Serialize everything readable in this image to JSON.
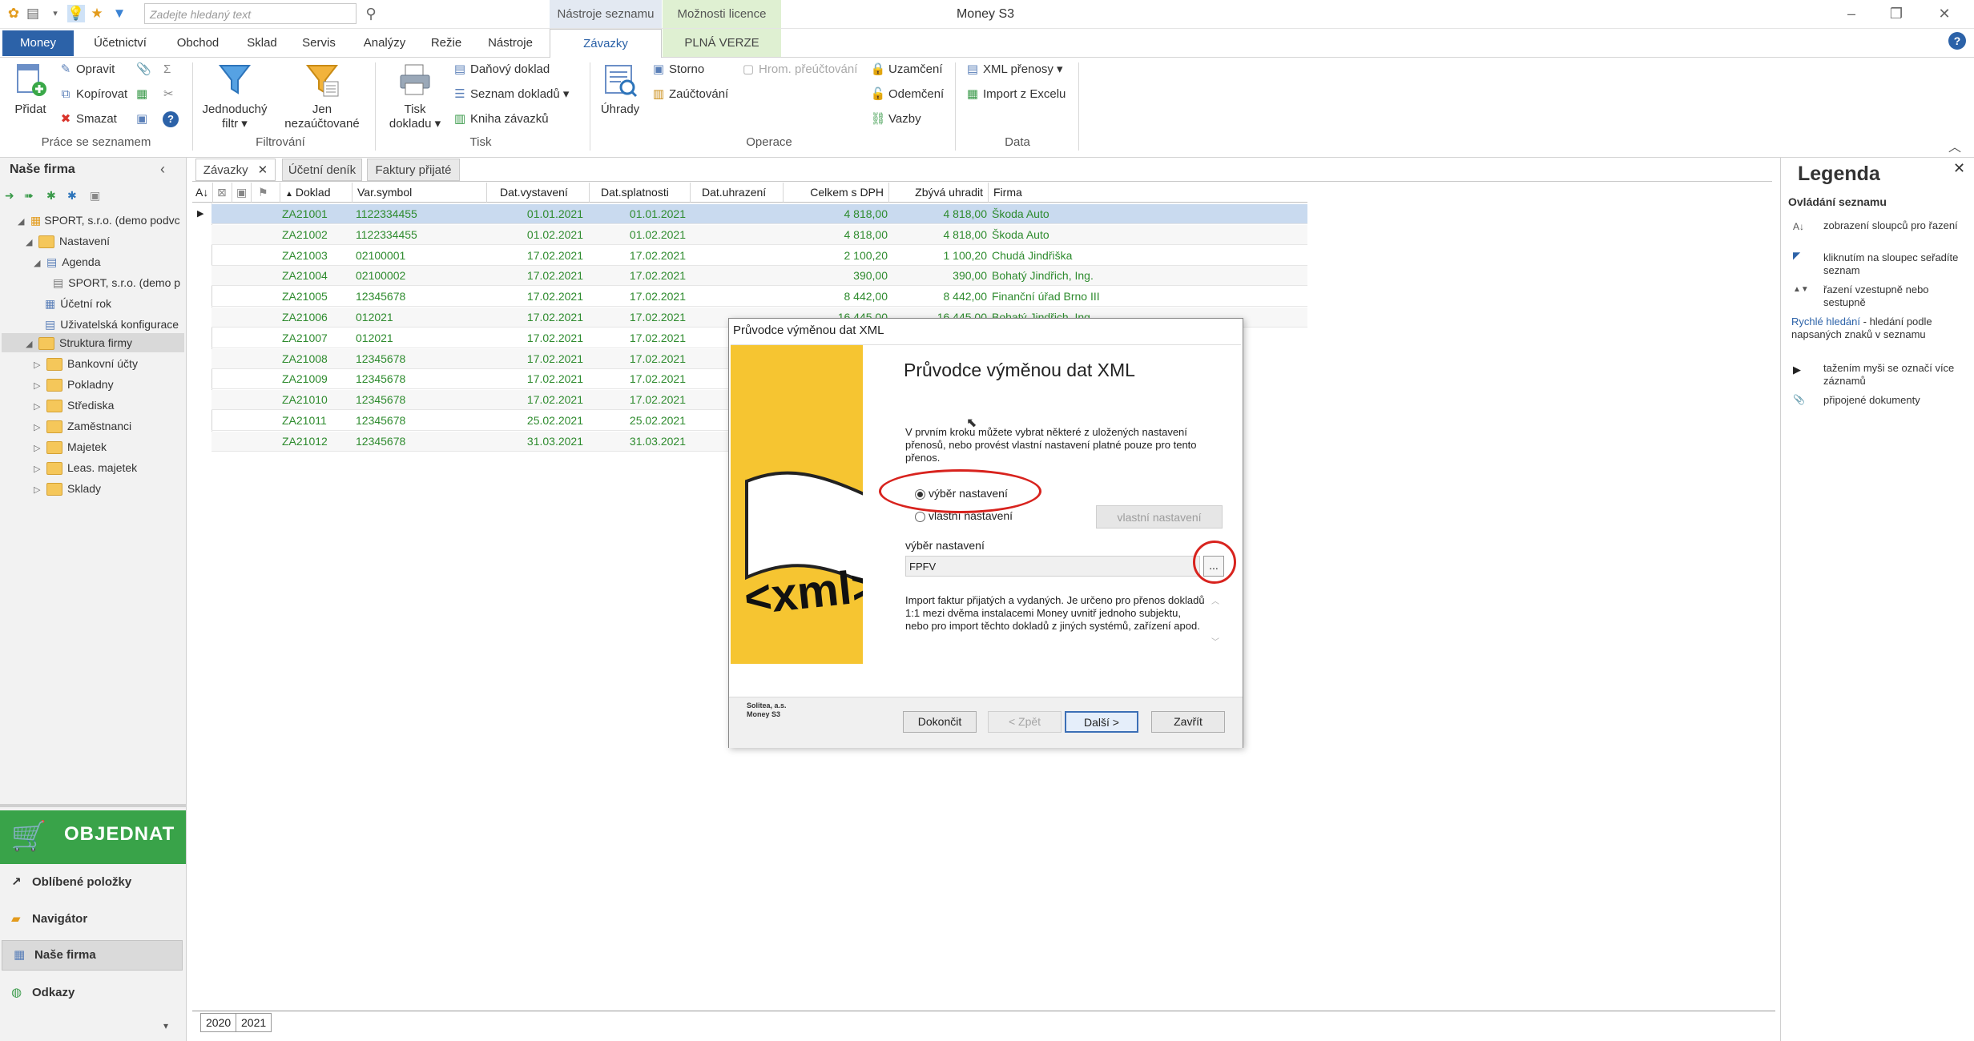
{
  "titlebar": {
    "search_placeholder": "Zadejte hledaný text",
    "context_tab_1": "Nástroje seznamu",
    "context_tab_2": "Možnosti licence",
    "window_title": "Money S3",
    "minimize": "–",
    "restore": "❐",
    "close": "✕"
  },
  "menu": {
    "money": "Money",
    "items": [
      "Účetnictví",
      "Obchod",
      "Sklad",
      "Servis",
      "Analýzy",
      "Režie",
      "Nástroje"
    ],
    "zavazky": "Závazky",
    "plna_verze": "PLNÁ VERZE"
  },
  "ribbon": {
    "pridat": "Přidat",
    "opravit": "Opravit",
    "kopirovat": "Kopírovat",
    "smazat": "Smazat",
    "group_prace": "Práce se seznamem",
    "jednoduchy_1": "Jednoduchý",
    "jednoduchy_2": "filtr ▾",
    "jen_1": "Jen",
    "jen_2": "nezaúčtované",
    "group_filtrovani": "Filtrování",
    "tisk_1": "Tisk",
    "tisk_2": "dokladu ▾",
    "danovy_doklad": "Daňový doklad",
    "seznam_dokladu": "Seznam dokladů ▾",
    "kniha_zavazku": "Kniha závazků",
    "group_tisk": "Tisk",
    "uhrady": "Úhrady",
    "storno": "Storno",
    "zauctovani": "Zaúčtování",
    "hrom_preuctovani": "Hrom. přeúčtování",
    "uzamceni": "Uzamčení",
    "odemceni": "Odemčení",
    "vazby": "Vazby",
    "group_operace": "Operace",
    "xml_prenosy": "XML přenosy ▾",
    "import_excel": "Import z Excelu",
    "group_data": "Data"
  },
  "left": {
    "title": "Naše firma",
    "tree": [
      {
        "label": "SPORT, s.r.o. (demo podvc"
      },
      {
        "label": "Nastavení"
      },
      {
        "label": "Agenda"
      },
      {
        "label": "SPORT, s.r.o. (demo p"
      },
      {
        "label": "Účetní rok"
      },
      {
        "label": "Uživatelská konfigurace"
      },
      {
        "label": "Struktura firmy"
      },
      {
        "label": "Bankovní účty"
      },
      {
        "label": "Pokladny"
      },
      {
        "label": "Střediska"
      },
      {
        "label": "Zaměstnanci"
      },
      {
        "label": "Majetek"
      },
      {
        "label": "Leas. majetek"
      },
      {
        "label": "Sklady"
      }
    ],
    "objednat": "OBJEDNAT",
    "nav": [
      "Oblíbené položky",
      "Navigátor",
      "Naše firma",
      "Odkazy"
    ]
  },
  "doc_tabs": [
    "Závazky",
    "Účetní deník",
    "Faktury přijaté"
  ],
  "grid": {
    "headers": [
      "Doklad",
      "Var.symbol",
      "Dat.vystavení",
      "Dat.splatnosti",
      "Dat.uhrazení",
      "Celkem s DPH",
      "Zbývá uhradit",
      "Firma"
    ],
    "rows": [
      [
        "ZA21001",
        "1122334455",
        "01.01.2021",
        "01.01.2021",
        "",
        "4 818,00",
        "4 818,00",
        "Škoda Auto"
      ],
      [
        "ZA21002",
        "1122334455",
        "01.02.2021",
        "01.02.2021",
        "",
        "4 818,00",
        "4 818,00",
        "Škoda Auto"
      ],
      [
        "ZA21003",
        "02100001",
        "17.02.2021",
        "17.02.2021",
        "",
        "2 100,20",
        "1 100,20",
        "Chudá Jindřiška"
      ],
      [
        "ZA21004",
        "02100002",
        "17.02.2021",
        "17.02.2021",
        "",
        "390,00",
        "390,00",
        "Bohatý Jindřich, Ing."
      ],
      [
        "ZA21005",
        "12345678",
        "17.02.2021",
        "17.02.2021",
        "",
        "8 442,00",
        "8 442,00",
        "Finanční úřad Brno III"
      ],
      [
        "ZA21006",
        "012021",
        "17.02.2021",
        "17.02.2021",
        "",
        "16 445,00",
        "16 445,00",
        "Bohatý Jindřich, Ing."
      ],
      [
        "ZA21007",
        "012021",
        "17.02.2021",
        "17.02.2021",
        "",
        "",
        "",
        ""
      ],
      [
        "ZA21008",
        "12345678",
        "17.02.2021",
        "17.02.2021",
        "",
        "",
        "",
        ""
      ],
      [
        "ZA21009",
        "12345678",
        "17.02.2021",
        "17.02.2021",
        "",
        "",
        "",
        ""
      ],
      [
        "ZA21010",
        "12345678",
        "17.02.2021",
        "17.02.2021",
        "",
        "",
        "",
        ""
      ],
      [
        "ZA21011",
        "12345678",
        "25.02.2021",
        "25.02.2021",
        "",
        "",
        "",
        ""
      ],
      [
        "ZA21012",
        "12345678",
        "31.03.2021",
        "31.03.2021",
        "",
        "",
        "",
        ""
      ]
    ]
  },
  "year_tabs": [
    "2020",
    "2021"
  ],
  "legend": {
    "title": "Legenda",
    "subtitle": "Ovládání seznamu",
    "items": [
      "zobrazení sloupců pro řazení",
      "kliknutím na sloupec seřadíte seznam",
      "řazení vzestupně nebo sestupně",
      "- hledání podle napsaných znaků v seznamu",
      "tažením myši se označí více záznamů",
      "připojené dokumenty"
    ],
    "rychle_hledani": "Rychlé hledání"
  },
  "dialog": {
    "title": "Průvodce výměnou dat XML",
    "heading": "Průvodce výměnou dat XML",
    "description": "V prvním kroku můžete vybrat některé z uložených nastavení přenosů, nebo provést vlastní nastavení platné pouze pro tento přenos.",
    "radio_vyber": "výběr nastavení",
    "radio_vlastni": "vlastní nastavení",
    "btn_vlastni": "vlastní nastavení",
    "label_vyber": "výběr nastavení",
    "input_value": "FPFV",
    "browse": "...",
    "info": "Import faktur přijatých a vydaných. Je určeno pro přenos dokladů 1:1 mezi dvěma instalacemi Money uvnitř jednoho subjektu, nebo pro import těchto dokladů z jiných systémů, zařízení apod.",
    "company_1": "Solitea, a.s.",
    "company_2": "Money S3",
    "btn_dokoncit": "Dokončit",
    "btn_zpet": "< Zpět",
    "btn_dalsi": "Další >",
    "btn_zavrit": "Zavřít",
    "art_text": "<xml>"
  },
  "colors": {
    "accent": "#2c62a8",
    "green_rows": "#2e8b2e",
    "objednat": "#39a349",
    "highlight": "#d8231e"
  }
}
